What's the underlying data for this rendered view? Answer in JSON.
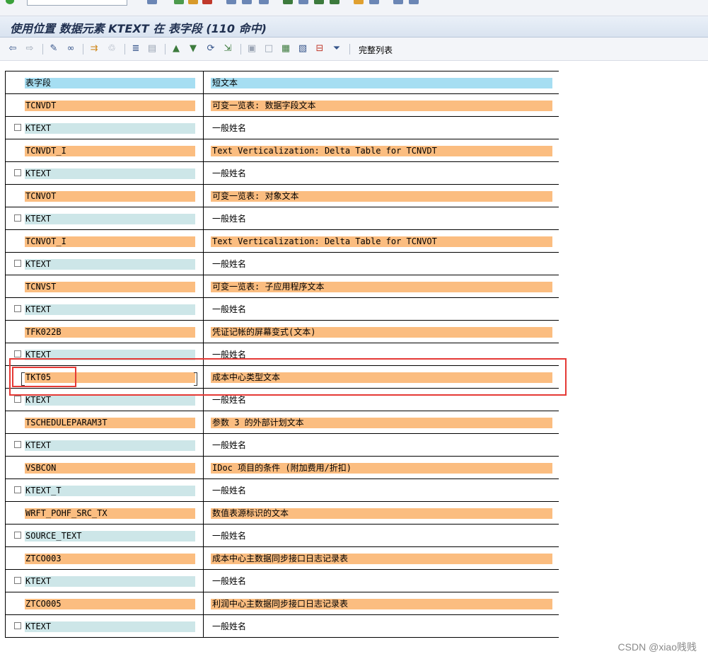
{
  "window_title": "使用位置 数据元素 KTEXT 在 表字段 (110 命中)",
  "toolbar": {
    "icons": [
      "back-arrow-icon",
      "forward-arrow-icon",
      "pencil-icon",
      "glasses-icon",
      "where-used-icon",
      "trash-icon",
      "align-icon",
      "layout-icon",
      "sort-ascending-icon",
      "sort-descending-icon",
      "refresh-icon",
      "export-icon",
      "select-all-icon",
      "deselect-icon",
      "find-icon",
      "find-next-icon",
      "delete-icon",
      "filter-icon"
    ],
    "complete_list_label": "完整列表"
  },
  "table": {
    "header": {
      "col1": "表字段",
      "col2": "短文本"
    },
    "rows": [
      {
        "kind": "table",
        "col1": "TCNVDT",
        "col2": "可变一览表: 数据字段文本"
      },
      {
        "kind": "field",
        "col1": "KTEXT",
        "col2": "一般姓名"
      },
      {
        "kind": "table",
        "col1": "TCNVDT_I",
        "col2": "Text Verticalization: Delta Table for TCNVDT"
      },
      {
        "kind": "field",
        "col1": "KTEXT",
        "col2": "一般姓名"
      },
      {
        "kind": "table",
        "col1": "TCNVOT",
        "col2": "可变一览表: 对象文本"
      },
      {
        "kind": "field",
        "col1": "KTEXT",
        "col2": "一般姓名"
      },
      {
        "kind": "table",
        "col1": "TCNVOT_I",
        "col2": "Text Verticalization: Delta Table for TCNVOT"
      },
      {
        "kind": "field",
        "col1": "KTEXT",
        "col2": "一般姓名"
      },
      {
        "kind": "table",
        "col1": "TCNVST",
        "col2": "可变一览表: 子应用程序文本"
      },
      {
        "kind": "field",
        "col1": "KTEXT",
        "col2": "一般姓名"
      },
      {
        "kind": "table",
        "col1": "TFK022B",
        "col2": "凭证记帐的屏幕变式(文本)"
      },
      {
        "kind": "field",
        "col1": "KTEXT",
        "col2": "一般姓名"
      },
      {
        "kind": "table",
        "col1": "TKT05",
        "col2": "成本中心类型文本"
      },
      {
        "kind": "field",
        "col1": "KTEXT",
        "col2": "一般姓名"
      },
      {
        "kind": "table",
        "col1": "TSCHEDULEPARAM3T",
        "col2": "参数 3 的外部计划文本"
      },
      {
        "kind": "field",
        "col1": "KTEXT",
        "col2": "一般姓名"
      },
      {
        "kind": "table",
        "col1": "VSBCON",
        "col2": "IDoc 项目的条件 (附加费用/折扣)"
      },
      {
        "kind": "field",
        "col1": "KTEXT_T",
        "col2": "一般姓名"
      },
      {
        "kind": "table",
        "col1": "WRFT_POHF_SRC_TX",
        "col2": "数值表源标识的文本"
      },
      {
        "kind": "field",
        "col1": "SOURCE_TEXT",
        "col2": "一般姓名"
      },
      {
        "kind": "table",
        "col1": "ZTCO003",
        "col2": "成本中心主数据同步接口日志记录表"
      },
      {
        "kind": "field",
        "col1": "KTEXT",
        "col2": "一般姓名"
      },
      {
        "kind": "table",
        "col1": "ZTCO005",
        "col2": "利润中心主数据同步接口日志记录表"
      },
      {
        "kind": "field",
        "col1": "KTEXT",
        "col2": "一般姓名"
      }
    ]
  },
  "colors": {
    "header_fill": "#a6def2",
    "table_row_fill": "#fbbd80",
    "field_key_fill": "#cde6e8",
    "highlight_outline": "#e53935"
  },
  "watermark": "CSDN @xiao贱贱"
}
